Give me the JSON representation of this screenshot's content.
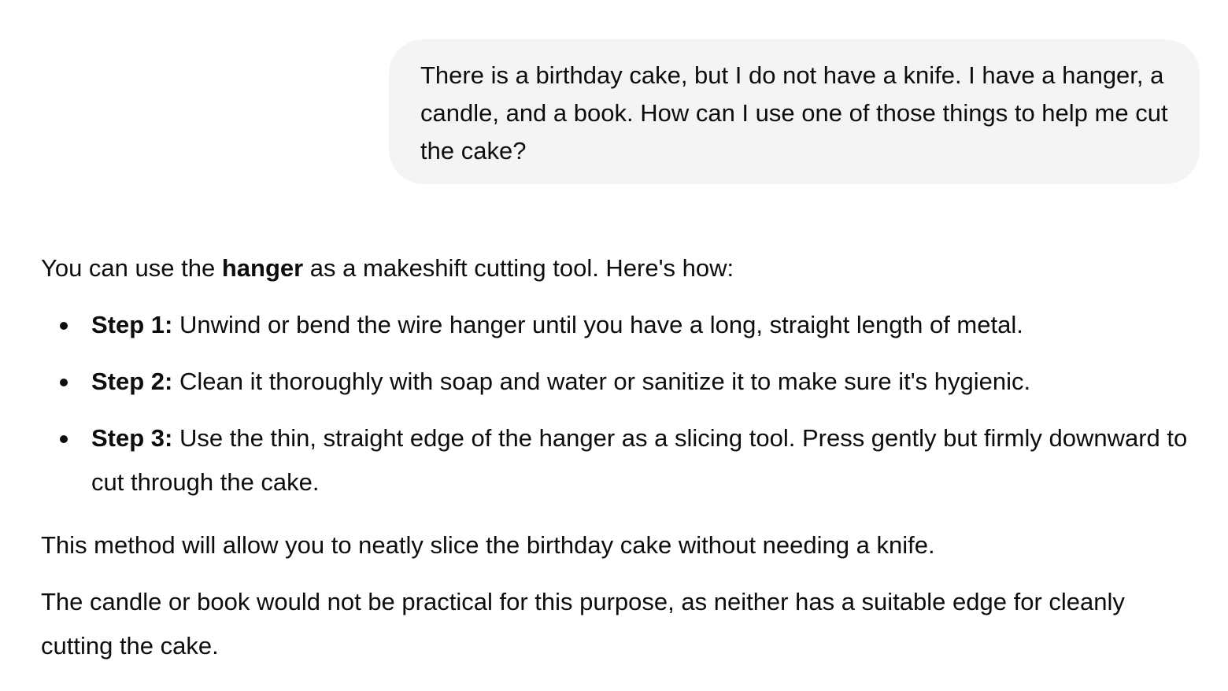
{
  "user_message": {
    "text": "There is a birthday cake, but I do not have a knife. I have a hanger, a candle, and a book. How can I use one of those things to help me cut the cake?"
  },
  "assistant_message": {
    "intro": {
      "before": "You can use the ",
      "bold": "hanger",
      "after": " as a makeshift cutting tool. Here's how:"
    },
    "steps": [
      {
        "label": "Step 1:",
        "text": " Unwind or bend the wire hanger until you have a long, straight length of metal."
      },
      {
        "label": "Step 2:",
        "text": " Clean it thoroughly with soap and water or sanitize it to make sure it's hygienic."
      },
      {
        "label": "Step 3:",
        "text": " Use the thin, straight edge of the hanger as a slicing tool. Press gently but firmly downward to cut through the cake."
      }
    ],
    "paragraph_1": "This method will allow you to neatly slice the birthday cake without needing a knife.",
    "paragraph_2": "The candle or book would not be practical for this purpose, as neither has a suitable edge for cleanly cutting the cake."
  },
  "colors": {
    "bubble_background": "#f4f4f4",
    "text": "#0d0d0d",
    "page_background": "#ffffff"
  }
}
